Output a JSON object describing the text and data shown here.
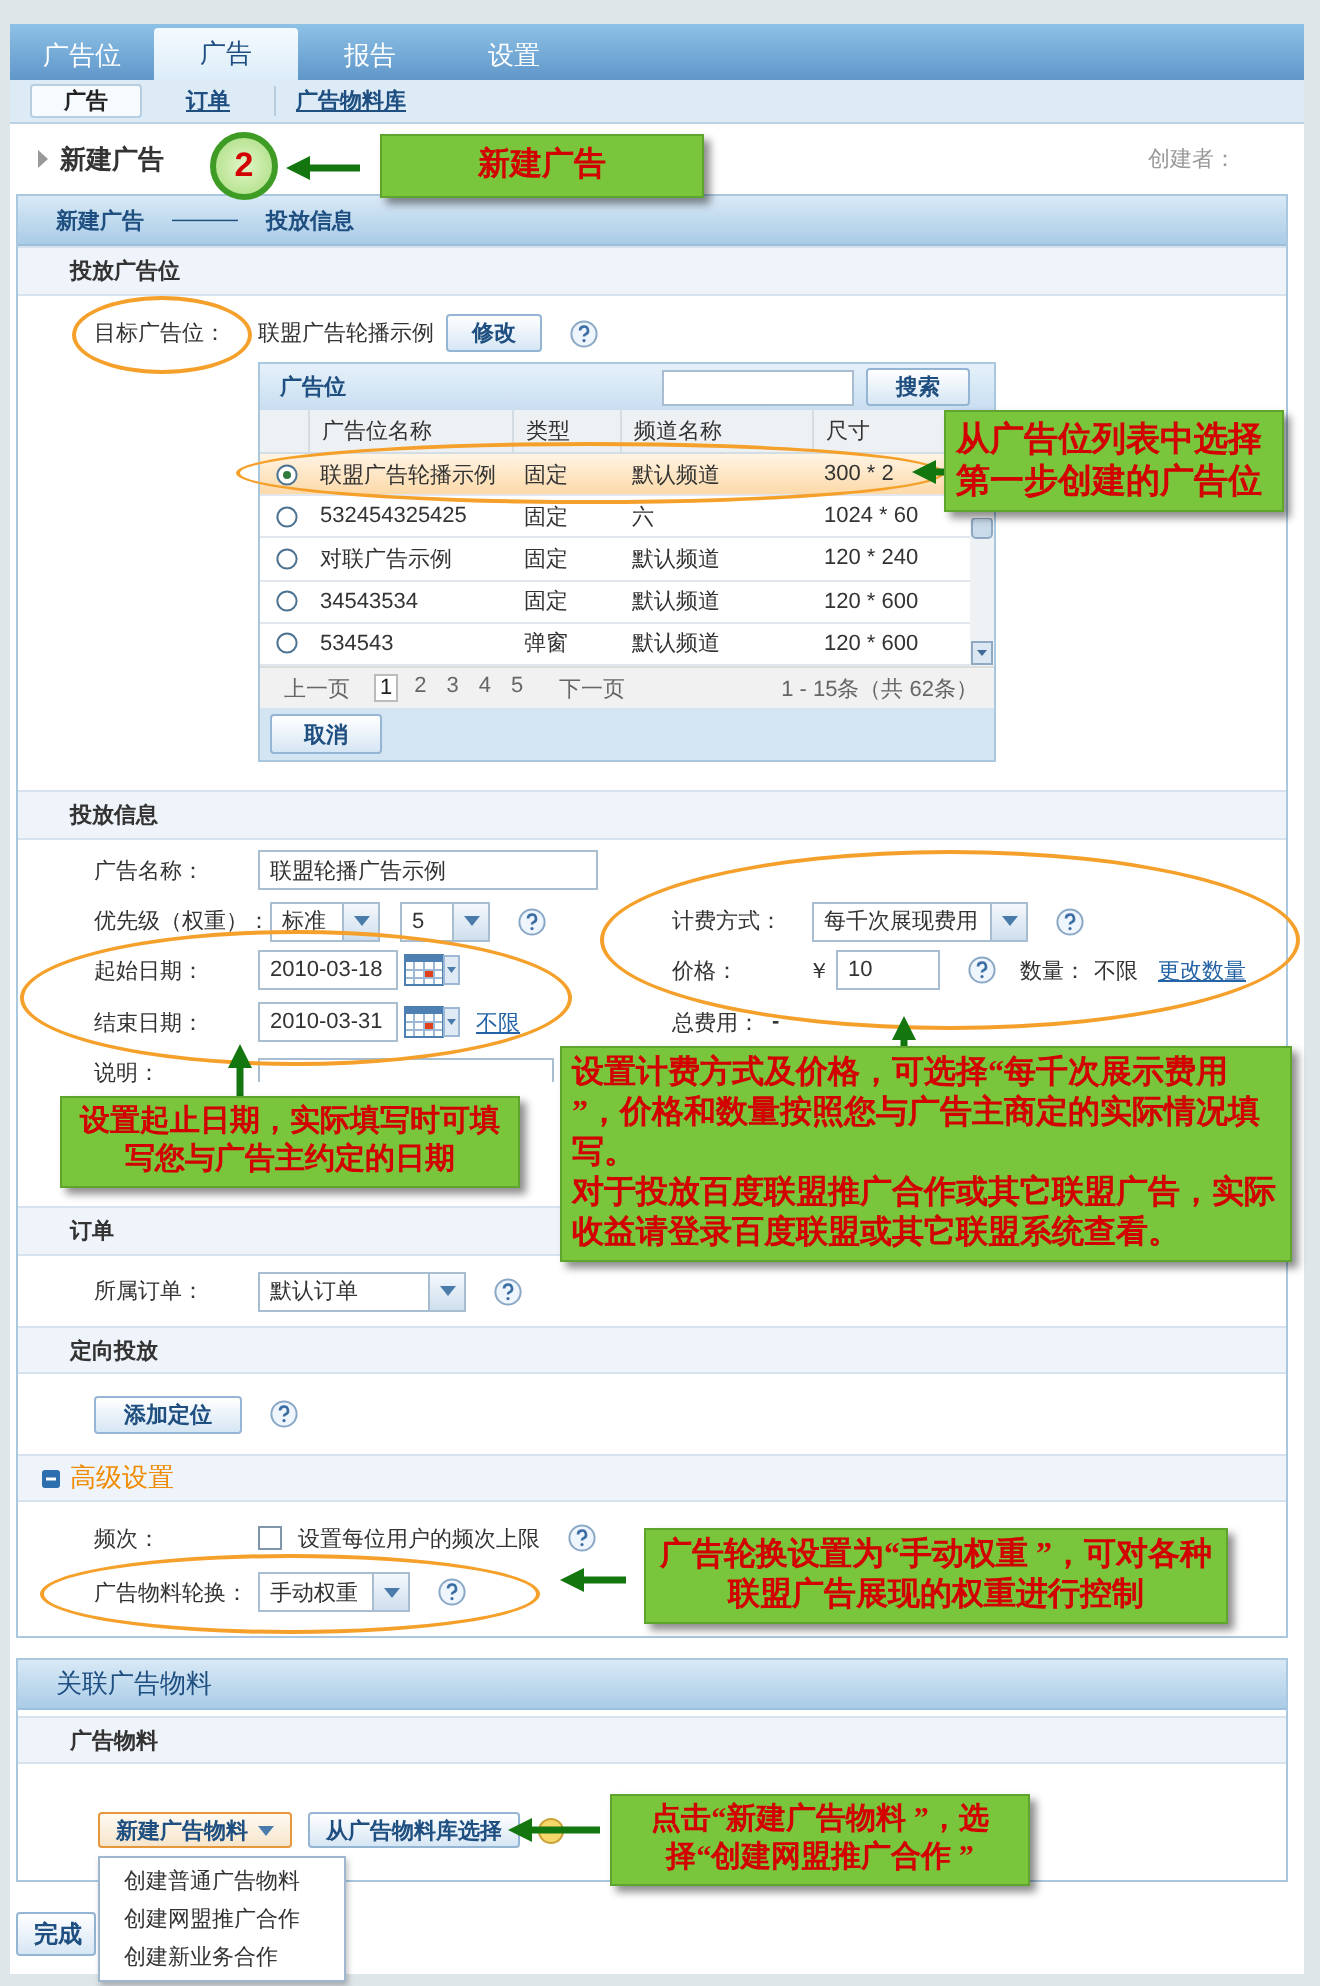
{
  "tabs": [
    {
      "label": "广告位",
      "selected": false
    },
    {
      "label": "广告",
      "selected": true
    },
    {
      "label": "报告",
      "selected": false
    },
    {
      "label": "设置",
      "selected": false
    }
  ],
  "subnav": [
    {
      "label": "广告",
      "selected": true
    },
    {
      "label": "订单",
      "selected": false
    },
    {
      "label": "广告物料库",
      "selected": false
    }
  ],
  "page_title": "新建广告",
  "creator_label": "创建者：",
  "steps": {
    "first": "新建广告",
    "separator": "———",
    "second": "投放信息"
  },
  "placement": {
    "title": "投放广告位",
    "label": "目标广告位：",
    "value": "联盟广告轮播示例",
    "modify_button": "修改"
  },
  "picker": {
    "title": "广告位",
    "search_button": "搜索",
    "columns": [
      "广告位名称",
      "类型",
      "频道名称",
      "尺寸"
    ],
    "rows": [
      {
        "cells": [
          "联盟广告轮播示例",
          "固定",
          "默认频道",
          "300 * 2"
        ],
        "selected": true
      },
      {
        "cells": [
          "532454325425",
          "固定",
          "六",
          "1024 * 60"
        ],
        "selected": false
      },
      {
        "cells": [
          "对联广告示例",
          "固定",
          "默认频道",
          "120 * 240"
        ],
        "selected": false
      },
      {
        "cells": [
          "34543534",
          "固定",
          "默认频道",
          "120 * 600"
        ],
        "selected": false
      },
      {
        "cells": [
          "534543",
          "弹窗",
          "默认频道",
          "120 * 600"
        ],
        "selected": false
      }
    ],
    "prev": "上一页",
    "pages": [
      {
        "label": "1",
        "selected": true
      },
      {
        "label": "2",
        "selected": false
      },
      {
        "label": "3",
        "selected": false
      },
      {
        "label": "4",
        "selected": false
      },
      {
        "label": "5",
        "selected": false
      }
    ],
    "next": "下一页",
    "summary": "1 - 15条（共 62条）",
    "cancel_button": "取消"
  },
  "delivery": {
    "title": "投放信息",
    "name_label": "广告名称：",
    "name_value": "联盟轮播广告示例",
    "priority_label": "优先级（权重）：",
    "priority_level": "标准",
    "priority_value": "5",
    "start_label": "起始日期：",
    "start_date": "2010-03-18",
    "end_label": "结束日期：",
    "end_date": "2010-03-31",
    "unlimited_link": "不限",
    "note_label": "说明：",
    "billing_label": "计费方式：",
    "billing_value": "每千次展现费用",
    "price_label": "价格：",
    "currency": "￥",
    "price_value": "10",
    "quantity_label": "数量：",
    "quantity_value": "不限",
    "change_quantity_link": "更改数量",
    "total_label": "总费用：",
    "total_value": "-"
  },
  "order": {
    "title": "订单",
    "label": "所属订单：",
    "value": "默认订单"
  },
  "targeting": {
    "title": "定向投放",
    "add_button": "添加定位"
  },
  "advanced": {
    "title": "高级设置",
    "expanded": true,
    "frequency_label": "频次：",
    "frequency_checkbox": {
      "label": "设置每位用户的频次上限",
      "checked": false
    },
    "rotation_label": "广告物料轮换：",
    "rotation_value": "手动权重"
  },
  "materials": {
    "title": "关联广告物料",
    "subtitle": "广告物料",
    "new_button": "新建广告物料",
    "library_button": "从广告物料库选择",
    "menu": [
      "创建普通广告物料",
      "创建网盟推广合作",
      "创建新业务合作"
    ]
  },
  "finish_button": "完成",
  "annotations": {
    "step_badge": "2",
    "title_callout": "新建广告",
    "slot_callout": "从广告位列表中选择第一步创建的广告位",
    "date_callout": "设置起止日期，实际填写时可填写您与广告主约定的日期",
    "billing_callout": [
      "设置计费方式及价格，可选择“每千次展示费用 ”，价格和数量按照您与广告主商定的实际情况填写。",
      "对于投放百度联盟推广合作或其它联盟广告，实际收益请登录百度联盟或其它联盟系统查看。"
    ],
    "rotation_callout": "广告轮换设置为“手动权重 ”，可对各种联盟广告展现的权重进行控制",
    "material_callout": "点击“新建广告物料 ”，选择“创建网盟推广合作 ”"
  }
}
